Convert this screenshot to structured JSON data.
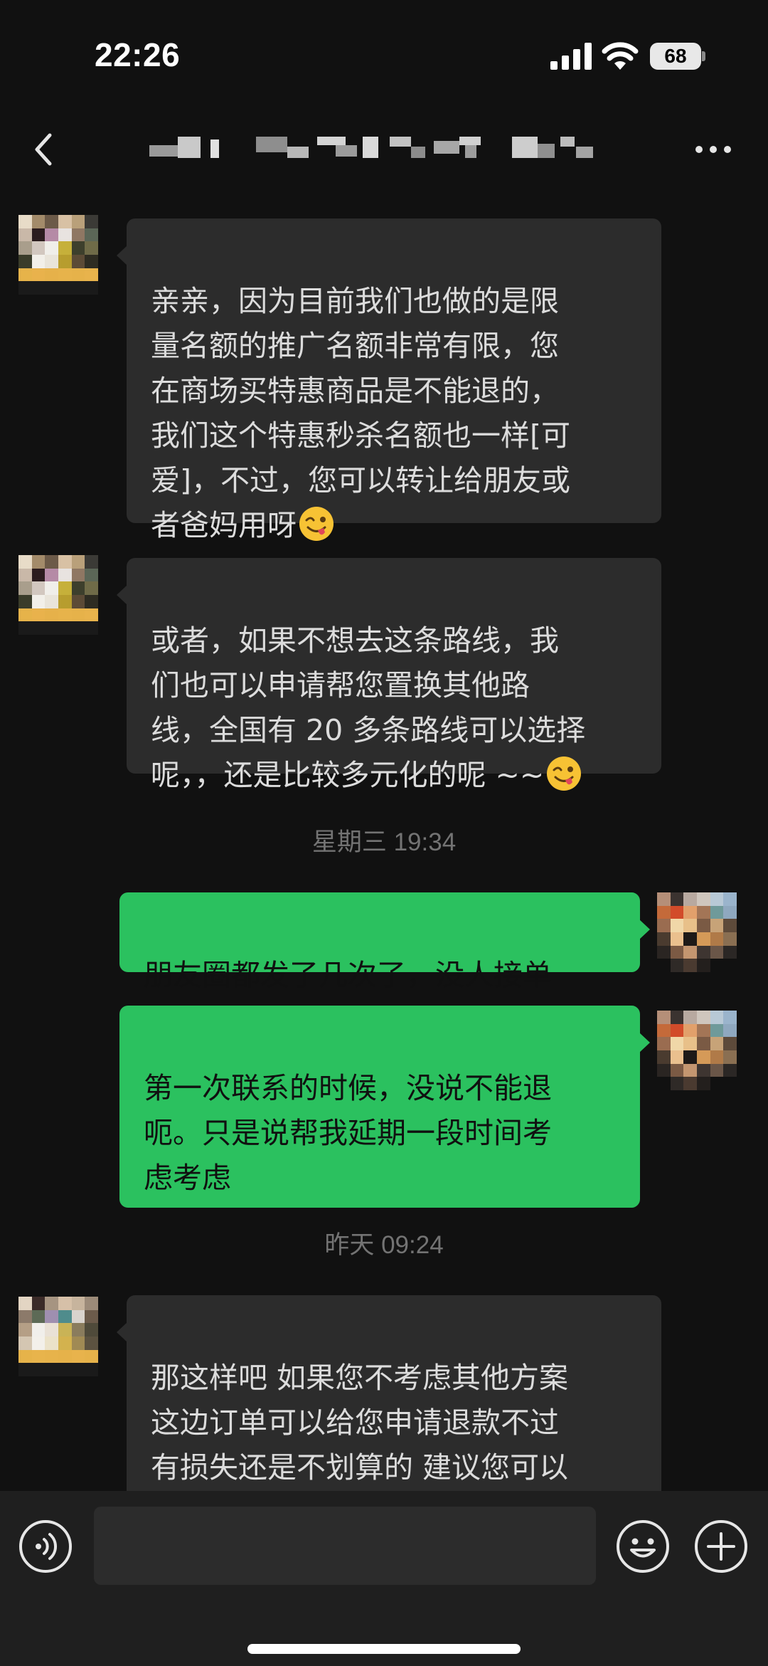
{
  "status_bar": {
    "time": "22:26",
    "battery": "68",
    "icons": [
      "cellular-signal-icon",
      "wifi-icon",
      "battery-icon"
    ]
  },
  "nav": {
    "title": "",
    "back_icon": "chevron-left-icon",
    "more_icon": "more-horizontal-icon"
  },
  "colors": {
    "background": "#111111",
    "incoming_bubble": "#2c2c2c",
    "outgoing_bubble": "#2bc15f",
    "timestamp": "#737373"
  },
  "messages": [
    {
      "direction": "incoming",
      "text": "亲亲，因为目前我们也做的是限\n量名额的推广名额非常有限，您\n在商场买特惠商品是不能退的，\n我们这个特惠秒杀名额也一样[可\n爱]，不过，您可以转让给朋友或\n者爸妈用呀",
      "emoji": "winking-tongue-face"
    },
    {
      "direction": "incoming",
      "text": "或者，如果不想去这条路线，我\n们也可以申请帮您置换其他路\n线，全国有 20 多条路线可以选择\n呢，，还是比较多元化的呢 ~~",
      "emoji": "winking-tongue-face"
    },
    {
      "type": "timestamp",
      "text": "星期三 19:34"
    },
    {
      "direction": "outgoing",
      "text": "朋友圈都发了几次了，没人接单"
    },
    {
      "direction": "outgoing",
      "text": "第一次联系的时候，没说不能退\n呃。只是说帮我延期一段时间考\n虑考虑"
    },
    {
      "type": "timestamp",
      "text": "昨天 09:24"
    },
    {
      "direction": "incoming",
      "text": "那这样吧 如果您不考虑其他方案\n这边订单可以给您申请退款不过\n有损失还是不划算的 建议您可以\n考虑上面的方案哈"
    }
  ],
  "input_bar": {
    "value": "",
    "placeholder": "",
    "voice_icon": "voice-input-icon",
    "emoji_icon": "emoji-face-icon",
    "plus_icon": "plus-circle-icon"
  }
}
